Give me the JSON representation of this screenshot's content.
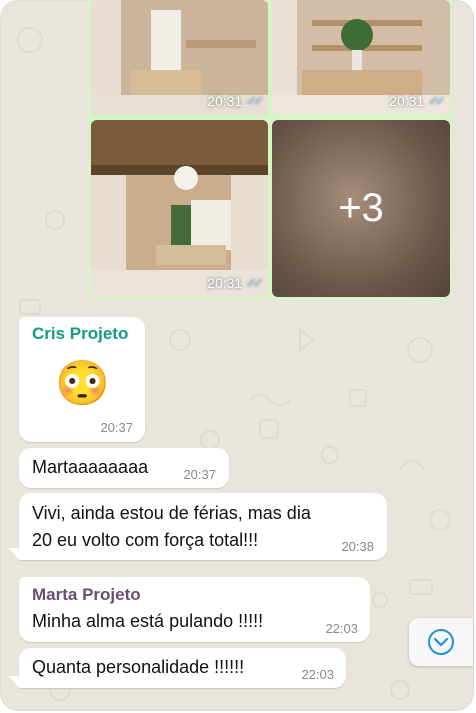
{
  "images": [
    {
      "time": "20:31"
    },
    {
      "time": "20:31"
    },
    {
      "time": "20:31"
    },
    {
      "time": "",
      "overlay": "+3"
    }
  ],
  "messages": [
    {
      "sender": "Cris Projeto",
      "sender_color": "#149c80",
      "emoji": "😳",
      "time": "20:37"
    },
    {
      "text": "Martaaaaaaaa",
      "time": "20:37"
    },
    {
      "text_line1": "Vivi, ainda estou de férias, mas dia",
      "text_line2": "20 eu volto com força total!!!",
      "time": "20:38"
    },
    {
      "sender": "Marta Projeto",
      "sender_color": "#6b4f72",
      "text": "Minha alma está pulando !!!!!",
      "time": "22:03"
    },
    {
      "text": "Quanta personalidade !!!!!!",
      "time": "22:03"
    }
  ],
  "icons": {
    "read": "double-check-icon",
    "scroll": "chevron-down-icon"
  },
  "colors": {
    "outgoing": "#d6f5c6",
    "incoming": "#ffffff",
    "tick": "#53bdeb"
  }
}
